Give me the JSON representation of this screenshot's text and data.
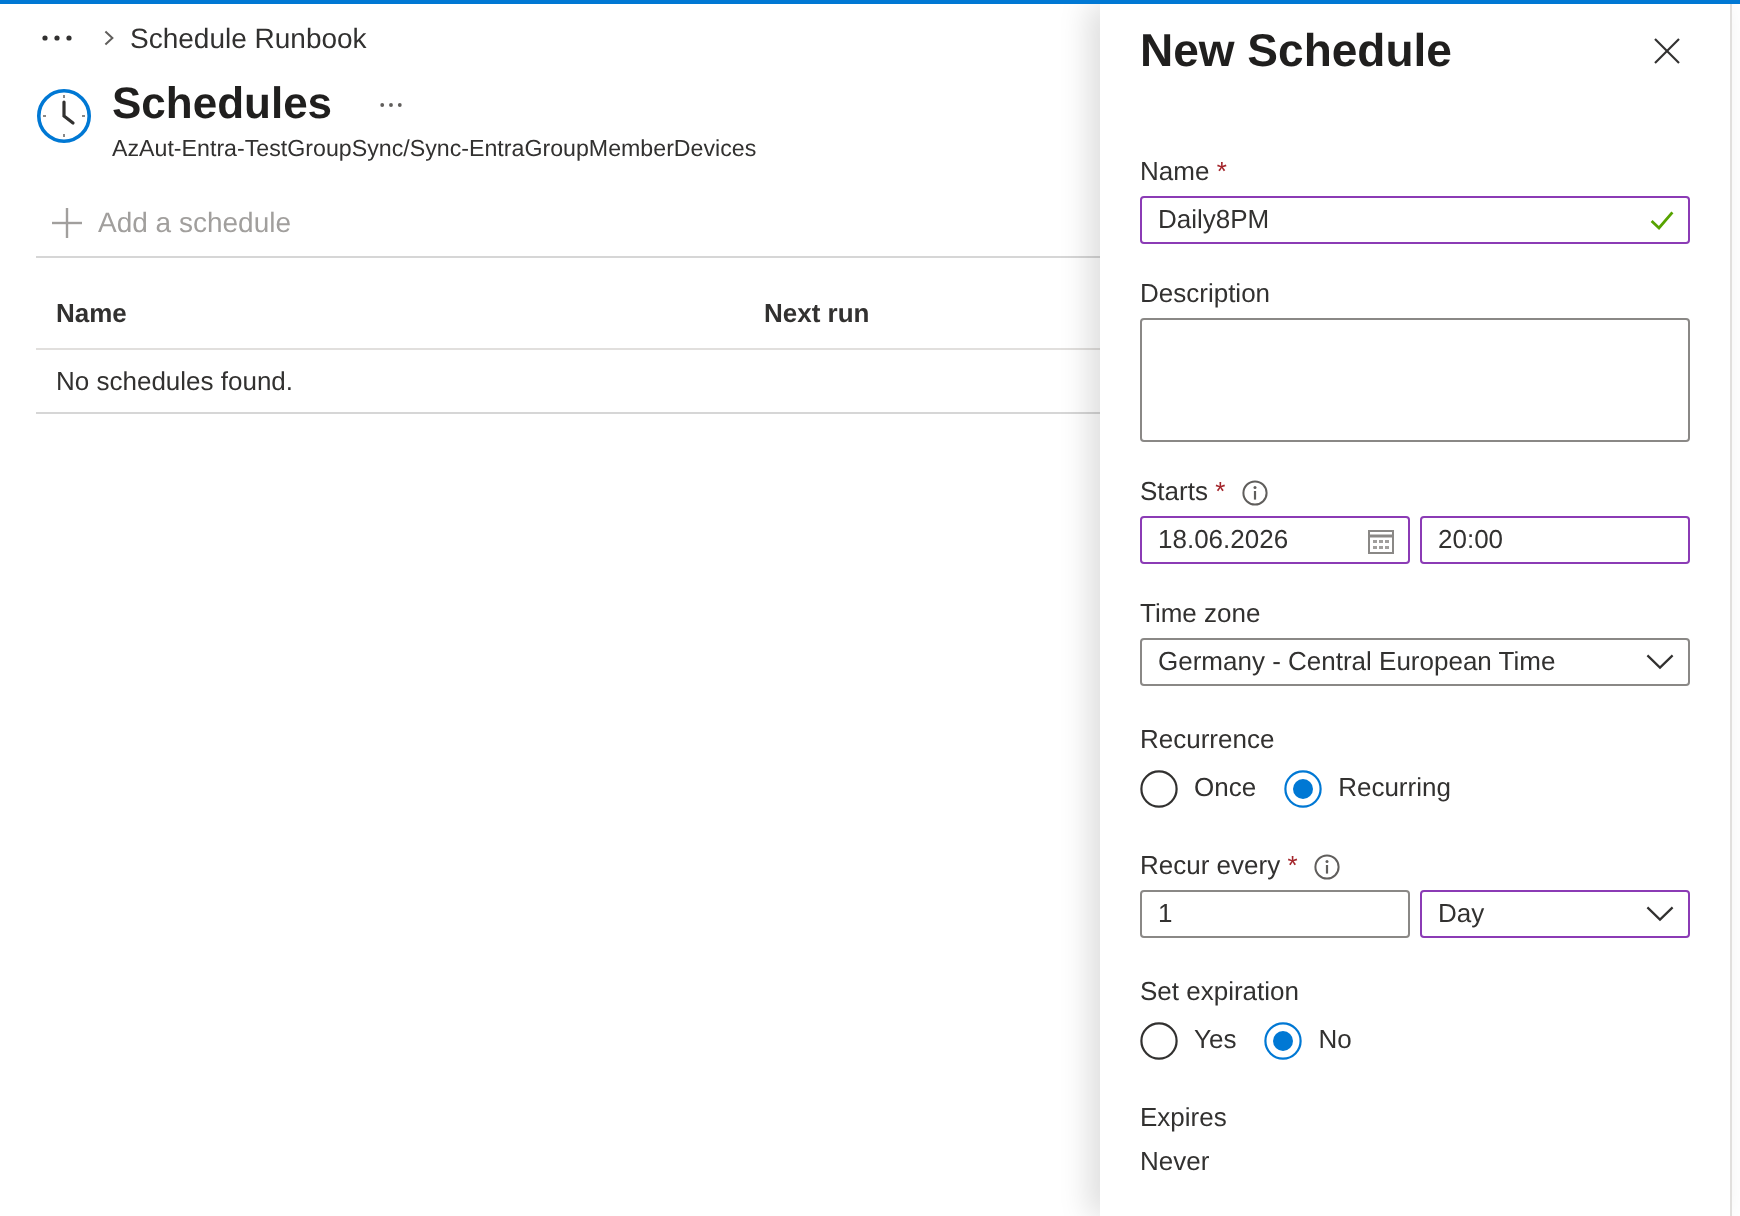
{
  "breadcrumb": {
    "items": [
      {
        "label": "Schedule Runbook"
      }
    ]
  },
  "header": {
    "title": "Schedules",
    "subtitle": "AzAut-Entra-TestGroupSync/Sync-EntraGroupMemberDevices"
  },
  "toolbar": {
    "buttons": [
      {
        "label": "Add a schedule",
        "disabled": true
      }
    ]
  },
  "table": {
    "columns": [
      "Name",
      "Next run"
    ],
    "empty_message": "No schedules found."
  },
  "panel": {
    "title": "New Schedule",
    "fields": [
      {
        "kind": "inputs",
        "label": "Name",
        "required_mark": "*",
        "inputs": [
          {
            "kind": "text",
            "value": "Daily8PM",
            "modified": true,
            "valid": true
          }
        ]
      },
      {
        "kind": "inputs",
        "label": "Description",
        "inputs": [
          {
            "kind": "textarea",
            "modified": false
          }
        ]
      },
      {
        "kind": "inputs",
        "label": "Starts",
        "required_mark": "*",
        "info": true,
        "inputs": [
          {
            "kind": "date",
            "value": "18.06.2026",
            "modified": true
          },
          {
            "kind": "time",
            "value": "20:00",
            "modified": true
          }
        ]
      },
      {
        "kind": "inputs",
        "label": "Time zone",
        "inputs": [
          {
            "kind": "select",
            "value": "Germany - Central European Time",
            "modified": false
          }
        ]
      },
      {
        "kind": "radios",
        "label": "Recurrence",
        "options": [
          {
            "label": "Once",
            "selected": false
          },
          {
            "label": "Recurring",
            "selected": true
          }
        ]
      },
      {
        "kind": "inputs",
        "label": "Recur every",
        "required_mark": "*",
        "info": true,
        "inputs": [
          {
            "kind": "text",
            "value": "1",
            "modified": false
          },
          {
            "kind": "select",
            "value": "Day",
            "modified": true
          }
        ]
      },
      {
        "kind": "radios",
        "label": "Set expiration",
        "options": [
          {
            "label": "Yes",
            "selected": false
          },
          {
            "label": "No",
            "selected": true
          }
        ]
      },
      {
        "kind": "value",
        "label": "Expires",
        "value": "Never"
      }
    ]
  }
}
